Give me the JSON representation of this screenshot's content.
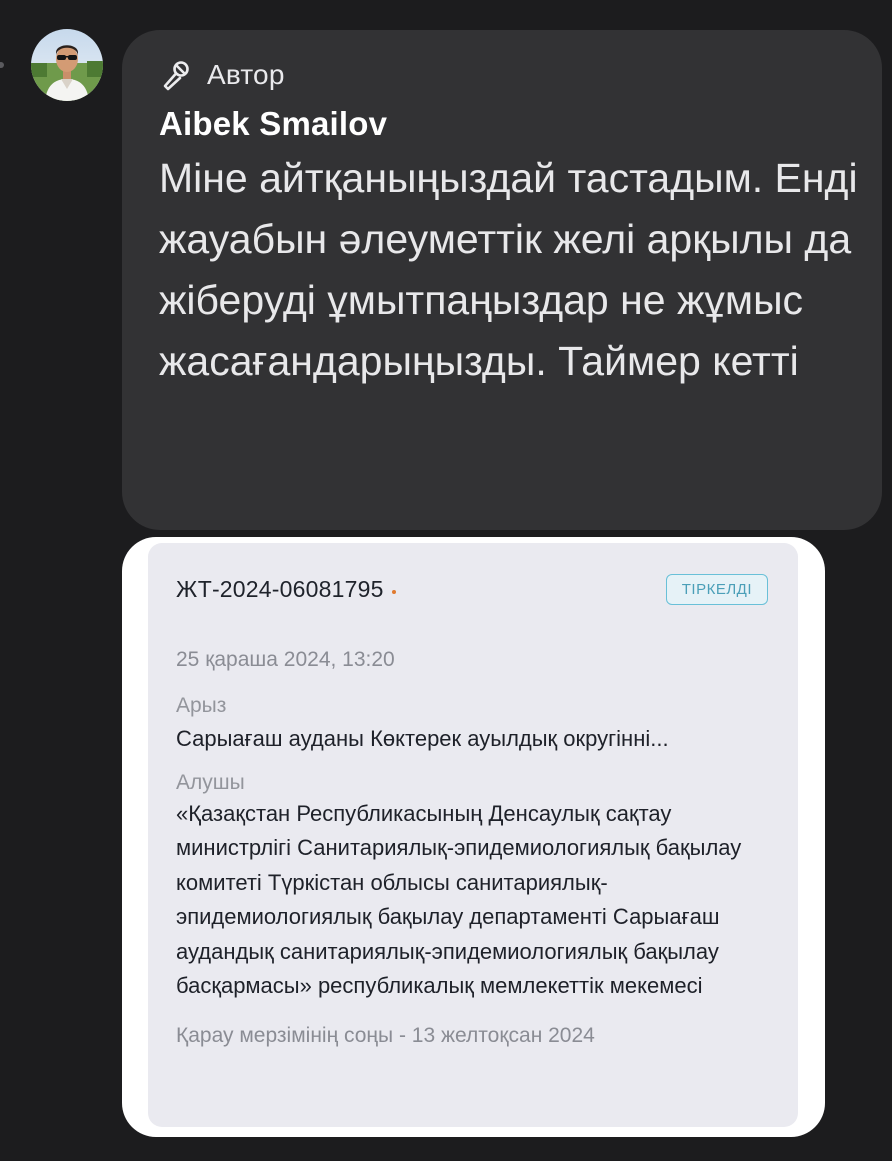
{
  "message": {
    "author_tag": "Автор",
    "author_name": "Aibek Smailov",
    "text": "Міне айтқаныңыздай тастадым. Енді жауабын әлеуметтік желі арқылы да жіберуді ұмытпаңыздар не жұмыс жасағандарыңызды. Таймер кетті"
  },
  "attachment": {
    "doc_id": "ЖТ-2024-06081795",
    "status": "ТІРКЕЛДІ",
    "date": "25 қараша 2024, 13:20",
    "application_label": "Арыз",
    "application_value": "Сарыағаш ауданы Көктерек ауылдық округінні...",
    "recipient_label": "Алушы",
    "recipient_value": "«Қазақстан Республикасының Денсаулық сақтау министрлігі Санитариялық-эпидемиологиялық бақылау комитеті Түркістан облысы санитариялық-эпидемиологиялық бақылау департаменті Сарыағаш аудандық санитариялық-эпидемиологиялық бақылау басқармасы» республикалық мемлекеттік мекемесі",
    "deadline": "Қарау мерзімінің соңы - 13 желтоқсан 2024"
  },
  "icons": {
    "author_badge": "microphone-icon"
  },
  "colors": {
    "background": "#1c1c1e",
    "bubble": "#323234",
    "status_badge": "#4b9fb8",
    "doc_dot": "#e07a2f"
  }
}
